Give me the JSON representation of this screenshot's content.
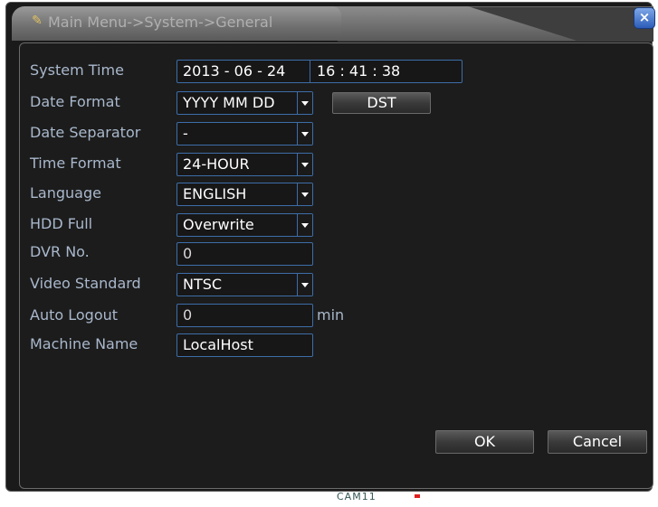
{
  "window": {
    "title": "Main Menu->System->General",
    "close_label": "×"
  },
  "fields": {
    "system_time": {
      "label": "System Time",
      "date": "2013 - 06 - 24",
      "time": "16 : 41 : 38"
    },
    "date_format": {
      "label": "Date Format",
      "value": "YYYY MM DD"
    },
    "date_separator": {
      "label": "Date Separator",
      "value": "-"
    },
    "time_format": {
      "label": "Time Format",
      "value": "24-HOUR"
    },
    "language": {
      "label": "Language",
      "value": "ENGLISH"
    },
    "hdd_full": {
      "label": "HDD Full",
      "value": "Overwrite"
    },
    "dvr_no": {
      "label": "DVR No.",
      "value": "0"
    },
    "video_standard": {
      "label": "Video Standard",
      "value": "NTSC"
    },
    "auto_logout": {
      "label": "Auto Logout",
      "value": "0",
      "unit": "min"
    },
    "machine_name": {
      "label": "Machine Name",
      "value": "LocalHost"
    }
  },
  "buttons": {
    "dst": "DST",
    "ok": "OK",
    "cancel": "Cancel"
  },
  "background_text": "CAM11",
  "colors": {
    "label": "#a9b8cc",
    "field_border": "#3d6da8",
    "panel_bg": "#1c1c1c",
    "close_button": "#2c5cb8"
  }
}
